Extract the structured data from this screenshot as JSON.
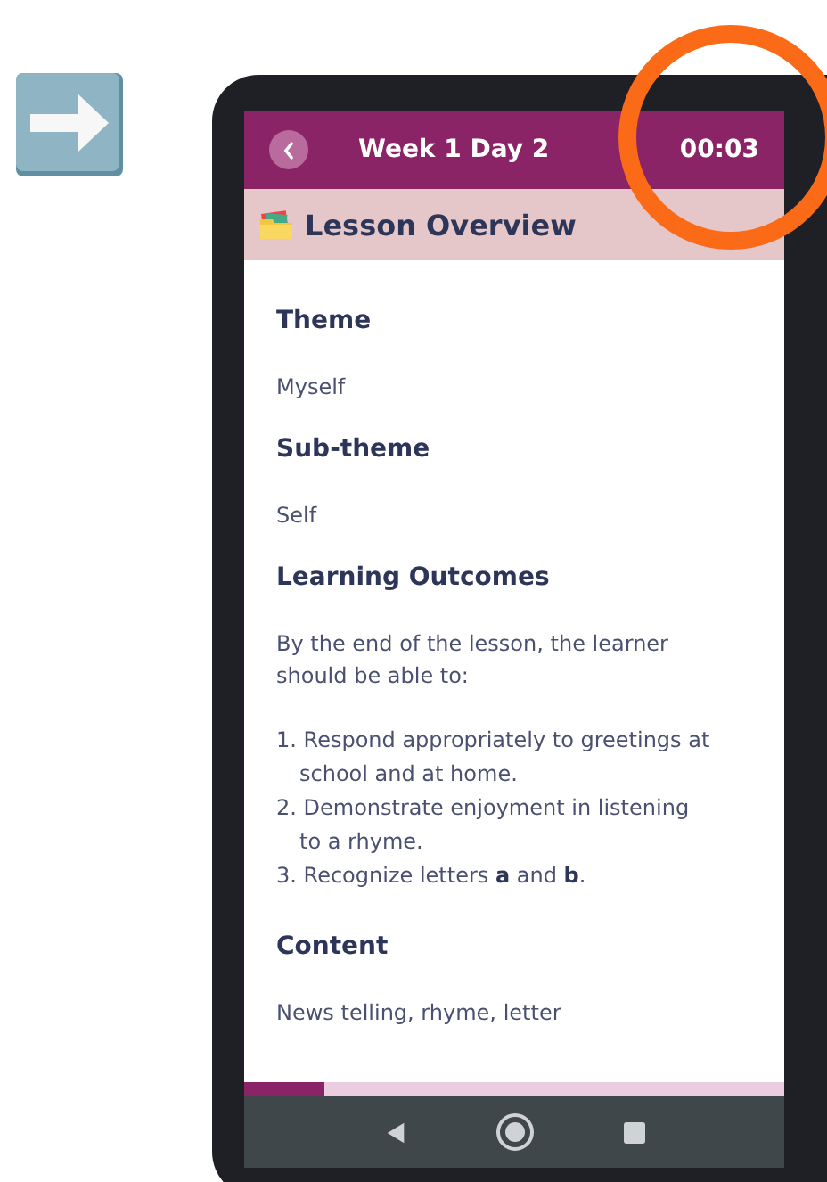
{
  "header": {
    "title": "Week 1 Day 2",
    "timer": "00:03"
  },
  "section": {
    "title": "Lesson Overview"
  },
  "blocks": [
    {
      "kind": "heading",
      "text": "Theme"
    },
    {
      "kind": "paragraph",
      "text": "Myself"
    },
    {
      "kind": "heading",
      "text": "Sub-theme"
    },
    {
      "kind": "paragraph",
      "text": "Self"
    },
    {
      "kind": "heading",
      "text": "Learning Outcomes"
    },
    {
      "kind": "paragraph",
      "text": "By the end of the lesson, the learner should be able to:"
    },
    {
      "kind": "list",
      "items": [
        "1. Respond appropriately to greetings at school and at home.",
        "2. Demonstrate enjoyment in listening to a rhyme.",
        "3. Recognize letters **a** and **b**."
      ]
    },
    {
      "kind": "heading",
      "text": "Content"
    },
    {
      "kind": "paragraph",
      "text": "News telling, rhyme, letter"
    }
  ],
  "progress": {
    "level": 0.15
  }
}
